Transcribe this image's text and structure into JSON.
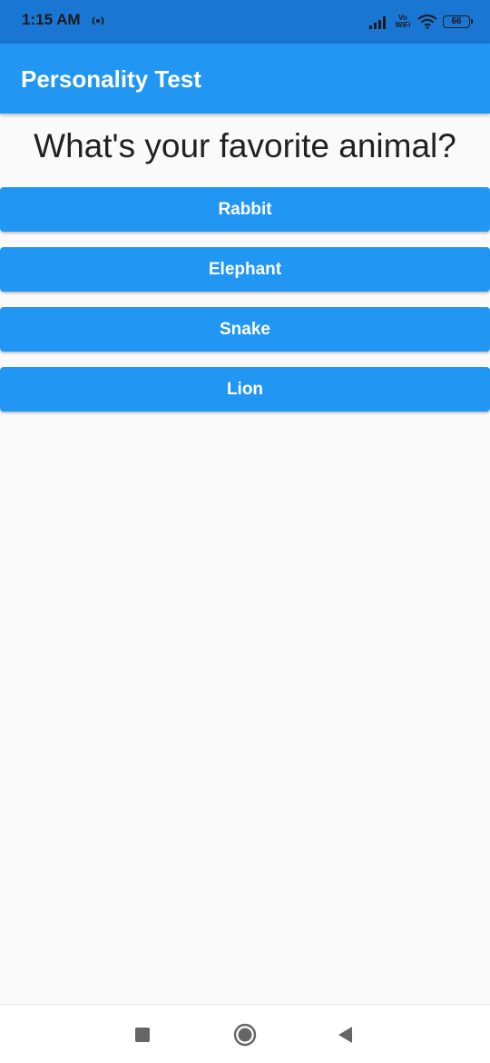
{
  "status_bar": {
    "time": "1:15 AM",
    "network_label_top": "Vo",
    "network_label_bottom": "WiFi",
    "battery": "66",
    "icons": [
      "radio-icon",
      "signal-icon",
      "wifi-icon",
      "battery-icon"
    ]
  },
  "app_bar": {
    "title": "Personality Test"
  },
  "quiz": {
    "question": "What's your favorite animal?",
    "answers": [
      {
        "label": "Rabbit"
      },
      {
        "label": "Elephant"
      },
      {
        "label": "Snake"
      },
      {
        "label": "Lion"
      }
    ]
  },
  "nav_bar": {
    "icons": [
      "recents-icon",
      "home-icon",
      "back-icon"
    ]
  },
  "colors": {
    "primary": "#2196f3",
    "status_bar": "#1976d2",
    "background": "#fafafa",
    "question_text": "#212121"
  }
}
